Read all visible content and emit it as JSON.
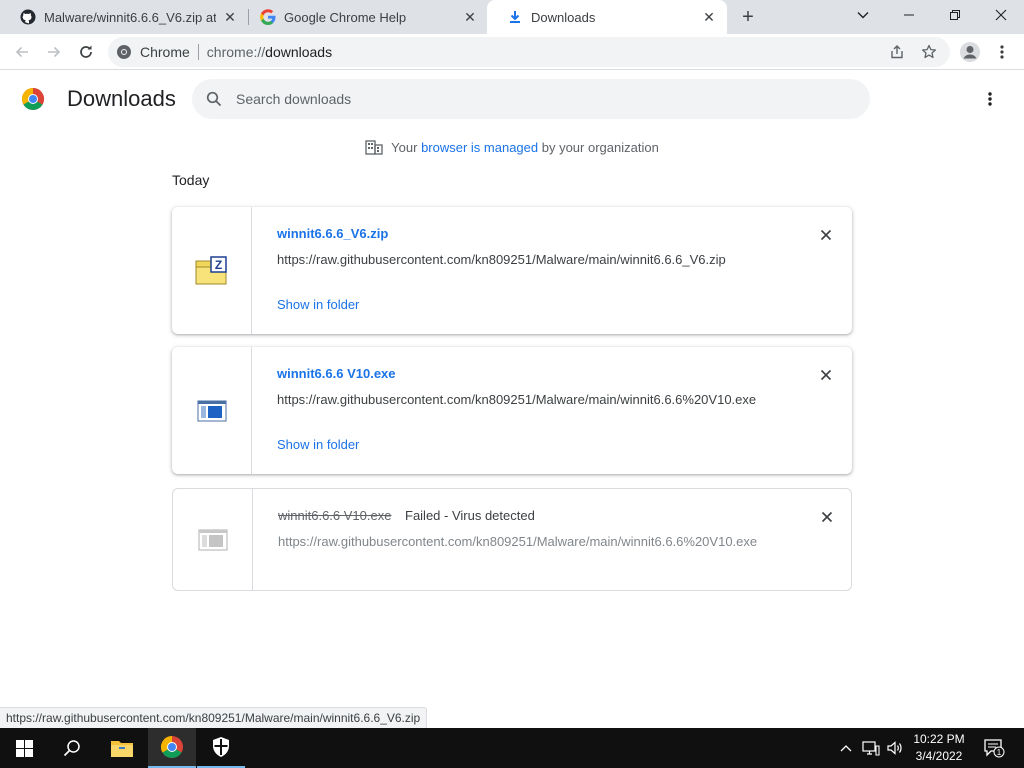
{
  "tabs": [
    {
      "title": "Malware/winnit6.6.6_V6.zip at main",
      "icon": "github-icon",
      "active": false
    },
    {
      "title": "Google Chrome Help",
      "icon": "google-icon",
      "active": false
    },
    {
      "title": "Downloads",
      "icon": "download-icon",
      "active": true
    }
  ],
  "toolbar": {
    "site_label": "Chrome",
    "url_scheme": "chrome://",
    "url_path": "downloads"
  },
  "downloads_page": {
    "title": "Downloads",
    "search_placeholder": "Search downloads",
    "managed_prefix": "Your ",
    "managed_link": "browser is managed",
    "managed_suffix": " by your organization",
    "section_label": "Today"
  },
  "downloads": [
    {
      "filename": "winnit6.6.6_V6.zip",
      "url": "https://raw.githubusercontent.com/kn809251/Malware/main/winnit6.6.6_V6.zip",
      "action": "Show in folder",
      "file_icon": "zip-file-icon"
    },
    {
      "filename": "winnit6.6.6 V10.exe",
      "url": "https://raw.githubusercontent.com/kn809251/Malware/main/winnit6.6.6%20V10.exe",
      "action": "Show in folder",
      "file_icon": "exe-file-icon"
    },
    {
      "filename": "winnit6.6.6 V10.exe",
      "status": "Failed - Virus detected",
      "url": "https://raw.githubusercontent.com/kn809251/Malware/main/winnit6.6.6%20V10.exe",
      "file_icon": "exe-file-icon"
    }
  ],
  "status_bubble": "https://raw.githubusercontent.com/kn809251/Malware/main/winnit6.6.6_V6.zip",
  "taskbar": {
    "time": "10:22 PM",
    "date": "3/4/2022",
    "notification_count": "1"
  },
  "colors": {
    "accent": "#1a73e8",
    "tabstrip": "#dee1e6",
    "taskbar": "#101010"
  }
}
